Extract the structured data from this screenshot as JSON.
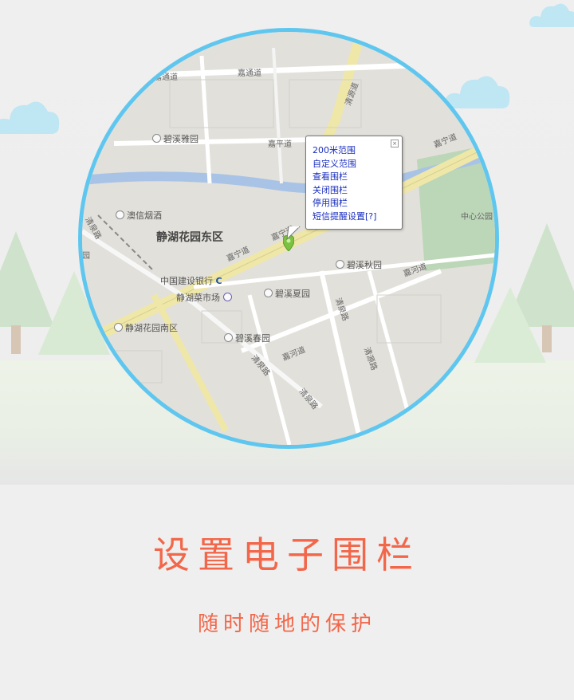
{
  "map": {
    "popup_menu": [
      "200米范围",
      "自定义范围",
      "查看围栏",
      "关闭围栏",
      "停用围栏",
      "短信提醒设置[?]"
    ],
    "labels": {
      "jiatong_dao_left": "嘉通道",
      "jiatong_dao_right": "嘉通道",
      "qingyuan_dao_top": "清源道",
      "bixi_yayuan": "碧溪雅园",
      "jiaping_dao": "嘉平道",
      "jianing_dao_right": "嘉宁道",
      "aoxin_yanjiu": "澳信烟酒",
      "zhongxin_gongyuan": "中心公园",
      "jinghu_east": "静湖花园东区",
      "jianing_dao_mid": "嘉宁道",
      "jianing_dao_left": "嘉宁道",
      "qingquan_lu_left": "清泉路",
      "bixi_qiuyuan": "碧溪秋园",
      "jiahe_dao_right": "嘉河道",
      "ccb": "中国建设银行",
      "jinghu_market": "静湖菜市场",
      "bixi_xiayuan": "碧溪夏园",
      "qingquan_lu_mid": "清泉路",
      "jinghu_south": "静湖花园南区",
      "bixi_chunyuan": "碧溪春园",
      "jiahe_dao_mid": "嘉河道",
      "qingyuan_dao_low": "清源路",
      "qingquan_lu_low": "清泉路",
      "qingquan_lu_bottom": "清泉路",
      "yuan_edge": "园"
    },
    "close_glyph": "×"
  },
  "headline": "设置电子围栏",
  "subline": "随时随地的保护",
  "colors": {
    "accent": "#f2674a",
    "circle_border": "#5fc7ef",
    "menu_link": "#1a2fbf"
  }
}
